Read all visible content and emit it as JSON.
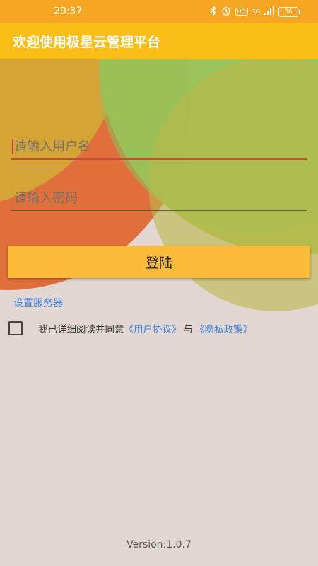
{
  "status_bar": {
    "time": "20:37",
    "network": "5G",
    "hd_label": "HD",
    "battery": "66",
    "icons": [
      "bluetooth-icon",
      "alarm-icon",
      "hd-icon",
      "signal-icon",
      "battery-icon"
    ]
  },
  "header": {
    "title": "欢迎使用极星云管理平台"
  },
  "login_form": {
    "username_placeholder": "请输入用户名",
    "username_value": "",
    "password_placeholder": "请输入密码",
    "password_value": "",
    "login_label": "登陆",
    "server_link": "设置服务器"
  },
  "agreement": {
    "checked": false,
    "prefix": "我已详细阅读并同意",
    "user_agreement": "《用户协议》",
    "conjunction": "与",
    "privacy_policy": "《隐私政策》"
  },
  "footer": {
    "version": "Version:1.0.7"
  },
  "colors": {
    "status_bar": "#f6a623",
    "title_bar": "#fbbd17",
    "button": "#fbba39",
    "link": "#3d7fd8",
    "background": "#e2d7d3"
  }
}
